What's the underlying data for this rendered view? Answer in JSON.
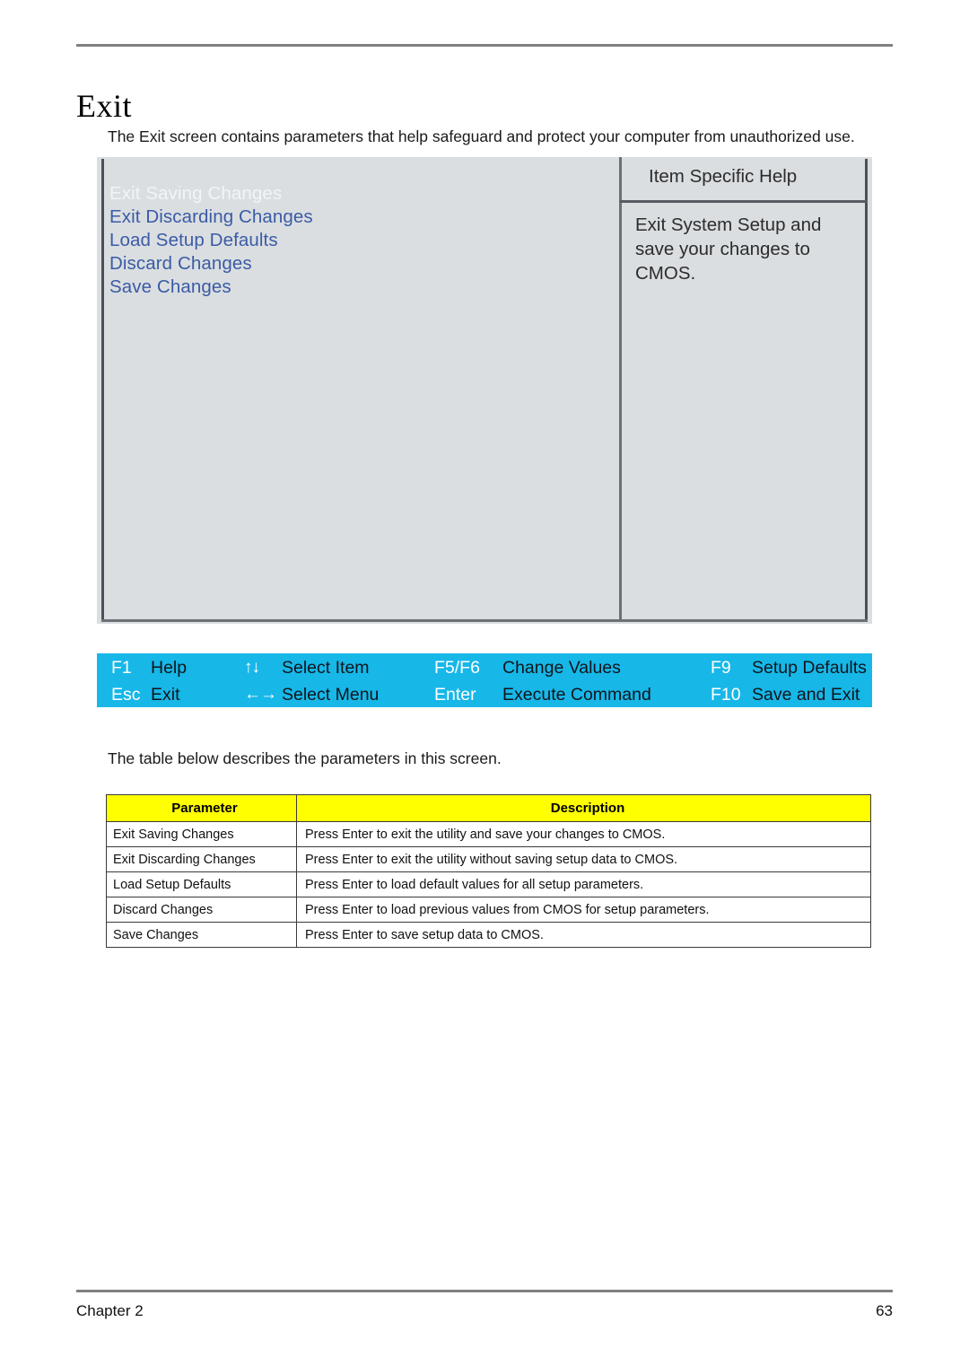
{
  "document": {
    "page_title": "Exit",
    "intro_text": "The Exit screen contains parameters that help safeguard and protect your computer from unauthorized use.",
    "mid_note": "The table below describes the parameters in this screen.",
    "footer_left": "Chapter 2",
    "footer_page_number": "63"
  },
  "bios_screen": {
    "menu_items": [
      {
        "label": "Exit Saving Changes",
        "selected": true
      },
      {
        "label": "Exit Discarding Changes",
        "selected": false
      },
      {
        "label": "Load Setup Defaults",
        "selected": false
      },
      {
        "label": "Discard Changes",
        "selected": false
      },
      {
        "label": "Save Changes",
        "selected": false
      }
    ],
    "help_panel": {
      "title": "Item Specific Help",
      "body": "Exit System Setup and save your changes to CMOS."
    },
    "function_keys": {
      "row1": [
        {
          "key": "F1",
          "label": "Help",
          "icon": ""
        },
        {
          "key": "",
          "icon": "updown-arrow-icon",
          "glyph": "↑↓",
          "label": "Select Item"
        },
        {
          "key": "F5/F6",
          "label": "Change Values",
          "icon": ""
        },
        {
          "key": "F9",
          "label": "Setup Defaults",
          "icon": ""
        }
      ],
      "row2": [
        {
          "key": "Esc",
          "label": "Exit",
          "icon": ""
        },
        {
          "key": "",
          "icon": "leftright-arrow-icon",
          "glyph": "←→",
          "label": "Select Menu"
        },
        {
          "key": "Enter",
          "label": "Execute  Command",
          "icon": ""
        },
        {
          "key": "F10",
          "label": "Save and Exit",
          "icon": ""
        }
      ]
    },
    "colors": {
      "panel_background": "#dadee1",
      "menu_item": "#3b5ba5",
      "menu_item_selected": "#f2f4f6",
      "function_bar": "#17b7e8",
      "function_key_text": "#ffffff",
      "function_label_text": "#11151b"
    }
  },
  "parameter_table": {
    "headers": [
      "Parameter",
      "Description"
    ],
    "header_background": "#ffff00",
    "rows": [
      {
        "parameter": "Exit Saving Changes",
        "description": "Press Enter to exit the utility and save your changes to CMOS."
      },
      {
        "parameter": "Exit Discarding Changes",
        "description": "Press Enter to exit the utility without saving setup data to CMOS."
      },
      {
        "parameter": "Load Setup Defaults",
        "description": "Press Enter to load default values for all setup parameters."
      },
      {
        "parameter": "Discard Changes",
        "description": "Press Enter to load previous values from CMOS for setup parameters."
      },
      {
        "parameter": "Save Changes",
        "description": "Press Enter to save setup data to CMOS."
      }
    ]
  }
}
